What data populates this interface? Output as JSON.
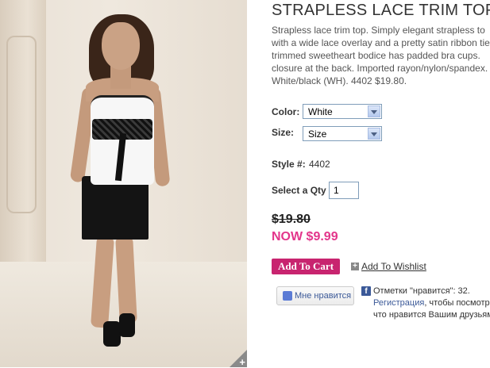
{
  "product": {
    "title": "STRAPLESS LACE TRIM TOP",
    "description_lines": [
      "Strapless lace trim top. Simply elegant strapless to",
      "with a wide lace overlay and a pretty satin ribbon tie",
      "trimmed sweetheart bodice has padded bra cups.",
      "closure at the back. Imported rayon/nylon/spandex.",
      "White/black (WH). 4402 $19.80."
    ]
  },
  "options": {
    "color_label": "Color:",
    "color_value": "White",
    "size_label": "Size:",
    "size_value": "Size",
    "style_label": "Style #:",
    "style_value": "4402",
    "qty_label": "Select a Qty",
    "qty_value": "1"
  },
  "pricing": {
    "old_price": "$19.80",
    "now_price": "NOW $9.99"
  },
  "actions": {
    "add_to_cart": "Add To Cart",
    "add_to_wishlist": "Add To Wishlist",
    "wishlist_icon": "+"
  },
  "social": {
    "like_button": "Мне нравится",
    "fb_logo": "f",
    "like_count_text": "Отметки \"нравится\": 32.",
    "register_link": "Регистрация",
    "register_rest": ", чтобы посмотр",
    "line3": "что нравится Вашим друзьям"
  },
  "image": {
    "zoom_icon": "+"
  },
  "colors": {
    "accent": "#c8246f",
    "now_price": "#e3358b",
    "facebook": "#3b5998"
  }
}
